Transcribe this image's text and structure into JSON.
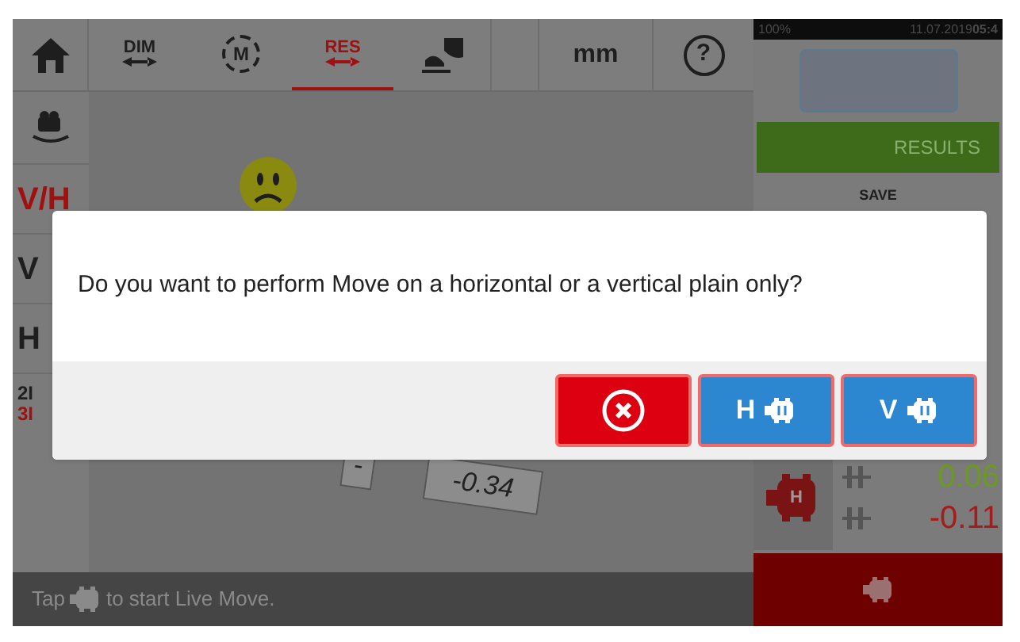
{
  "toolbar": {
    "tabs": [
      {
        "label": "DIM",
        "selected": false
      },
      {
        "label": "M",
        "selected": false
      },
      {
        "label": "RES",
        "selected": true
      }
    ],
    "units": "mm",
    "help": "?"
  },
  "side_panel": {
    "items": [
      {
        "label": "V/H",
        "active": true
      },
      {
        "label": "V",
        "active": false
      },
      {
        "label": "H",
        "active": false
      }
    ],
    "modes": [
      {
        "label": "2I",
        "selected": false
      },
      {
        "label": "3I",
        "selected": true
      }
    ]
  },
  "canvas": {
    "value_labels": [
      "-",
      "-0.34"
    ]
  },
  "hint": {
    "before": "Tap",
    "after": "to start Live Move."
  },
  "status_bar": {
    "battery": "100%",
    "date": "11.07.2019",
    "time": "05:4"
  },
  "results_panel": {
    "title": "RESULTS",
    "save": "SAVE",
    "machine_badge": "H",
    "values": [
      {
        "text": "0.06",
        "color": "#6a9a22"
      },
      {
        "text": "-0.11",
        "color": "#a51c1c"
      }
    ]
  },
  "dialog": {
    "message": "Do you want to perform Move on a horizontal or a vertical plain only?",
    "buttons": [
      {
        "kind": "cancel"
      },
      {
        "kind": "move",
        "label": "H"
      },
      {
        "kind": "move",
        "label": "V"
      }
    ]
  }
}
